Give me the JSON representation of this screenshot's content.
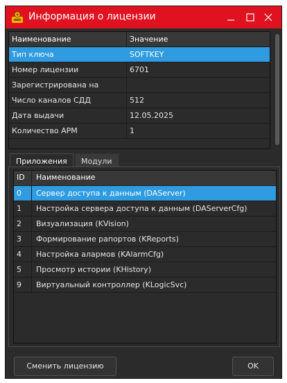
{
  "window": {
    "title": "Информация о лицензии",
    "titlebar_color": "#e0121f",
    "selection_color": "#2f9be0",
    "controls": {
      "minimize": "minimize-icon",
      "maximize": "maximize-icon",
      "close": "close-icon"
    }
  },
  "license_table": {
    "headers": [
      "Наименование",
      "Значение"
    ],
    "rows": [
      {
        "name": "Тип ключа",
        "value": "SOFTKEY",
        "selected": true
      },
      {
        "name": "Номер лицензии",
        "value": "6701"
      },
      {
        "name": "Зарегистрирована на",
        "value": ""
      },
      {
        "name": "Число каналов СДД",
        "value": "512"
      },
      {
        "name": "Дата выдачи",
        "value": "12.05.2025"
      },
      {
        "name": "Количество АРМ",
        "value": "1"
      }
    ]
  },
  "tabs": [
    {
      "label": "Приложения",
      "active": true
    },
    {
      "label": "Модули",
      "active": false
    }
  ],
  "apps_table": {
    "headers": [
      "ID",
      "Наименование"
    ],
    "rows": [
      {
        "id": "0",
        "name": "Сервер доступа к данным (DAServer)",
        "selected": true
      },
      {
        "id": "1",
        "name": "Настройка сервера доступа к данным (DAServerCfg)"
      },
      {
        "id": "2",
        "name": "Визуализация (KVision)"
      },
      {
        "id": "3",
        "name": "Формирование рапортов (KReports)"
      },
      {
        "id": "4",
        "name": "Настройка алармов (KAlarmCfg)"
      },
      {
        "id": "5",
        "name": "Просмотр истории (KHistory)"
      },
      {
        "id": "9",
        "name": "Виртуальный контроллер (KLogicSvc)"
      }
    ]
  },
  "buttons": {
    "change_license": "Сменить лицензию",
    "ok": "OK"
  }
}
